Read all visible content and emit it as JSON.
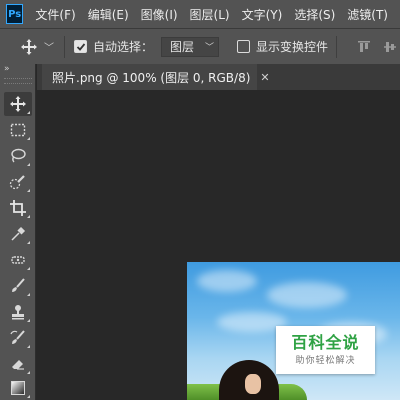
{
  "app": {
    "logo_text": "Ps"
  },
  "menu": [
    {
      "label": "文件(F)"
    },
    {
      "label": "编辑(E)"
    },
    {
      "label": "图像(I)"
    },
    {
      "label": "图层(L)"
    },
    {
      "label": "文字(Y)"
    },
    {
      "label": "选择(S)"
    },
    {
      "label": "滤镜(T)"
    }
  ],
  "options_bar": {
    "tool_icon": "move-icon",
    "auto_select": {
      "label": "自动选择：",
      "checked": true
    },
    "target_dropdown": {
      "value": "图层"
    },
    "show_transform": {
      "label": "显示变换控件",
      "checked": false
    }
  },
  "tools_panel": {
    "collapse_glyph": "»",
    "tools": [
      {
        "icon": "move-icon",
        "active": true
      },
      {
        "icon": "rectangular-marquee-icon",
        "active": false
      },
      {
        "icon": "lasso-icon",
        "active": false
      },
      {
        "icon": "quick-selection-icon",
        "active": false
      },
      {
        "icon": "crop-icon",
        "active": false
      },
      {
        "icon": "eyedropper-icon",
        "active": false
      },
      {
        "icon": "healing-brush-icon",
        "active": false
      },
      {
        "icon": "brush-icon",
        "active": false
      },
      {
        "icon": "clone-stamp-icon",
        "active": false
      },
      {
        "icon": "history-brush-icon",
        "active": false
      },
      {
        "icon": "eraser-icon",
        "active": false
      },
      {
        "icon": "gradient-icon",
        "active": false
      }
    ]
  },
  "document": {
    "tab_title": "照片.png @ 100% (图层 0, RGB/8)",
    "close_glyph": "✕"
  },
  "watermark": {
    "title": "百科全说",
    "subtitle": "助你轻松解决",
    "title_color": "#2fa244"
  },
  "colors": {
    "chrome": "#535353",
    "canvas_bg": "#282828",
    "accent": "#31a8ff"
  }
}
